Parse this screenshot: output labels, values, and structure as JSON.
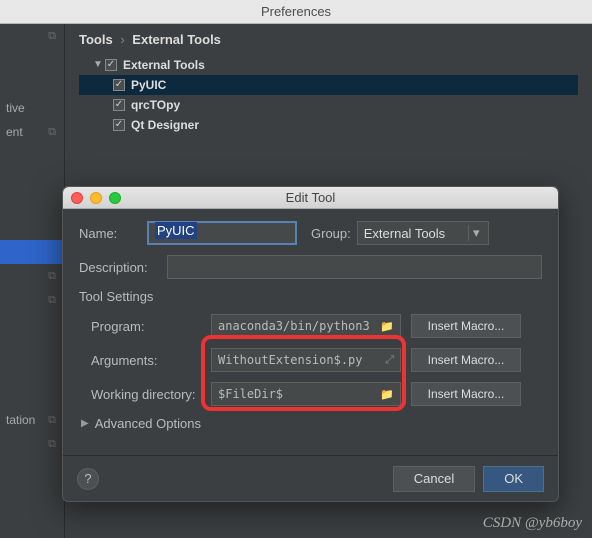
{
  "window_title": "Preferences",
  "breadcrumb": {
    "root": "Tools",
    "leaf": "External Tools"
  },
  "sidebar": {
    "items": [
      {
        "label": ""
      },
      {
        "label": ""
      },
      {
        "label": ""
      },
      {
        "label": "tive"
      },
      {
        "label": "ent"
      },
      {
        "label": ""
      },
      {
        "label": ""
      },
      {
        "label": ""
      },
      {
        "label": ""
      },
      {
        "label": ""
      },
      {
        "label": ""
      },
      {
        "label": ""
      },
      {
        "label": "tation"
      },
      {
        "label": ""
      }
    ]
  },
  "tree": {
    "root": {
      "label": "External Tools",
      "checked": true
    },
    "children": [
      {
        "label": "PyUIC",
        "checked": true,
        "selected": true
      },
      {
        "label": "qrcTOpy",
        "checked": true
      },
      {
        "label": "Qt Designer",
        "checked": true
      }
    ]
  },
  "modal": {
    "title": "Edit Tool",
    "labels": {
      "name": "Name:",
      "group": "Group:",
      "description": "Description:",
      "tool_settings": "Tool Settings",
      "program": "Program:",
      "arguments": "Arguments:",
      "working_dir": "Working directory:",
      "advanced": "Advanced Options",
      "insert_macro": "Insert Macro...",
      "cancel": "Cancel",
      "ok": "OK",
      "help": "?"
    },
    "values": {
      "name": "PyUIC",
      "group": "External Tools",
      "description": "",
      "program": "anaconda3/bin/python3",
      "arguments": "WithoutExtension$.py",
      "working_dir": "$FileDir$"
    }
  },
  "watermark": "CSDN @yb6boy"
}
